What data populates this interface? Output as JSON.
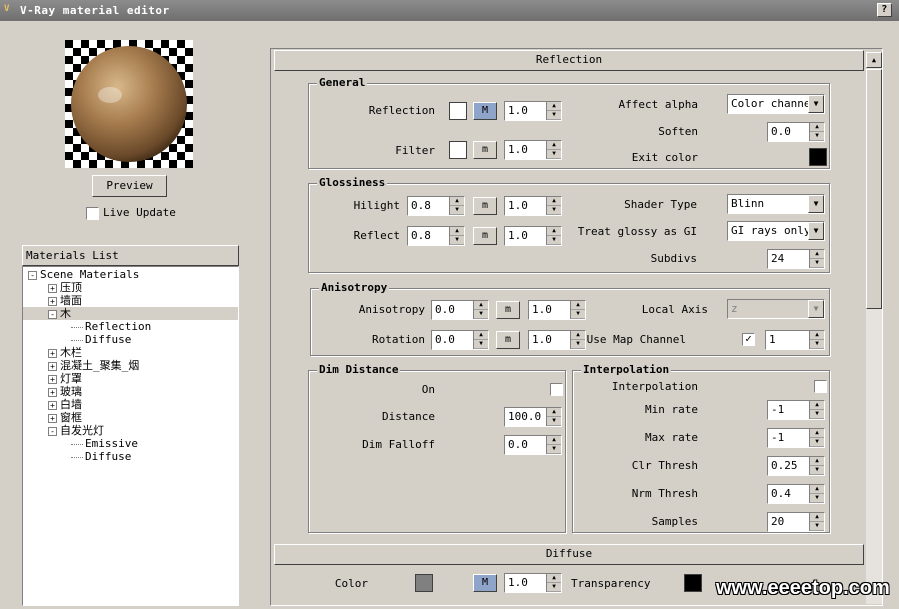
{
  "window": {
    "title": "V-Ray material editor",
    "help_label": "?"
  },
  "preview": {
    "button_label": "Preview",
    "live_update_label": "Live Update",
    "live_update_checked": false
  },
  "materials_list": {
    "header": "Materials List",
    "items": [
      {
        "label": "Scene Materials",
        "level": 0,
        "expander": "-"
      },
      {
        "label": "压顶",
        "level": 1,
        "expander": "+"
      },
      {
        "label": "墙面",
        "level": 1,
        "expander": "+"
      },
      {
        "label": "木",
        "level": 1,
        "expander": "-",
        "selected": true
      },
      {
        "label": "Reflection",
        "level": 2,
        "expander": ""
      },
      {
        "label": "Diffuse",
        "level": 2,
        "expander": ""
      },
      {
        "label": "木栏",
        "level": 1,
        "expander": "+"
      },
      {
        "label": "混凝土_聚集_烟",
        "level": 1,
        "expander": "+"
      },
      {
        "label": "灯罩",
        "level": 1,
        "expander": "+"
      },
      {
        "label": "玻璃",
        "level": 1,
        "expander": "+"
      },
      {
        "label": "白墙",
        "level": 1,
        "expander": "+"
      },
      {
        "label": "窗框",
        "level": 1,
        "expander": "+"
      },
      {
        "label": "自发光灯",
        "level": 1,
        "expander": "-"
      },
      {
        "label": "Emissive",
        "level": 2,
        "expander": ""
      },
      {
        "label": "Diffuse",
        "level": 2,
        "expander": ""
      }
    ]
  },
  "reflection_rollout": {
    "title": "Reflection"
  },
  "general": {
    "title": "General",
    "reflection_label": "Reflection",
    "reflection_m": "M",
    "reflection_value": "1.0",
    "filter_label": "Filter",
    "filter_m": "m",
    "filter_value": "1.0",
    "affect_alpha_label": "Affect alpha",
    "affect_alpha_value": "Color channel",
    "soften_label": "Soften",
    "soften_value": "0.0",
    "exit_color_label": "Exit color"
  },
  "glossiness": {
    "title": "Glossiness",
    "hilight_label": "Hilight",
    "hilight_value": "0.8",
    "hilight_m": "m",
    "hilight_mult": "1.0",
    "reflect_label": "Reflect",
    "reflect_value": "0.8",
    "reflect_m": "m",
    "reflect_mult": "1.0",
    "shader_type_label": "Shader Type",
    "shader_type_value": "Blinn",
    "treat_glossy_label": "Treat glossy as GI",
    "treat_glossy_value": "GI rays only",
    "subdivs_label": "Subdivs",
    "subdivs_value": "24"
  },
  "anisotropy": {
    "title": "Anisotropy",
    "anisotropy_label": "Anisotropy",
    "anisotropy_value": "0.0",
    "anisotropy_m": "m",
    "anisotropy_mult": "1.0",
    "rotation_label": "Rotation",
    "rotation_value": "0.0",
    "rotation_m": "m",
    "rotation_mult": "1.0",
    "local_axis_label": "Local Axis",
    "local_axis_value": "z",
    "use_map_channel_label": "Use Map Channel",
    "use_map_channel_checked": true,
    "map_channel_value": "1"
  },
  "dim_distance": {
    "title": "Dim Distance",
    "on_label": "On",
    "distance_label": "Distance",
    "distance_value": "100.0",
    "dim_falloff_label": "Dim Falloff",
    "dim_falloff_value": "0.0"
  },
  "interpolation": {
    "title": "Interpolation",
    "interpolation_label": "Interpolation",
    "min_rate_label": "Min rate",
    "min_rate_value": "-1",
    "max_rate_label": "Max rate",
    "max_rate_value": "-1",
    "clr_thresh_label": "Clr Thresh",
    "clr_thresh_value": "0.25",
    "nrm_thresh_label": "Nrm Thresh",
    "nrm_thresh_value": "0.4",
    "samples_label": "Samples",
    "samples_value": "20"
  },
  "diffuse_rollout": {
    "title": "Diffuse",
    "color_label": "Color",
    "color_m": "M",
    "color_value": "1.0",
    "transparency_label": "Transparency"
  },
  "watermark": "www.eeeetop.com",
  "colors": {
    "white_swatch": "#ffffff",
    "black_swatch": "#000000",
    "diffuse_swatch": "#808080",
    "m_active": "#8ea4c8"
  }
}
